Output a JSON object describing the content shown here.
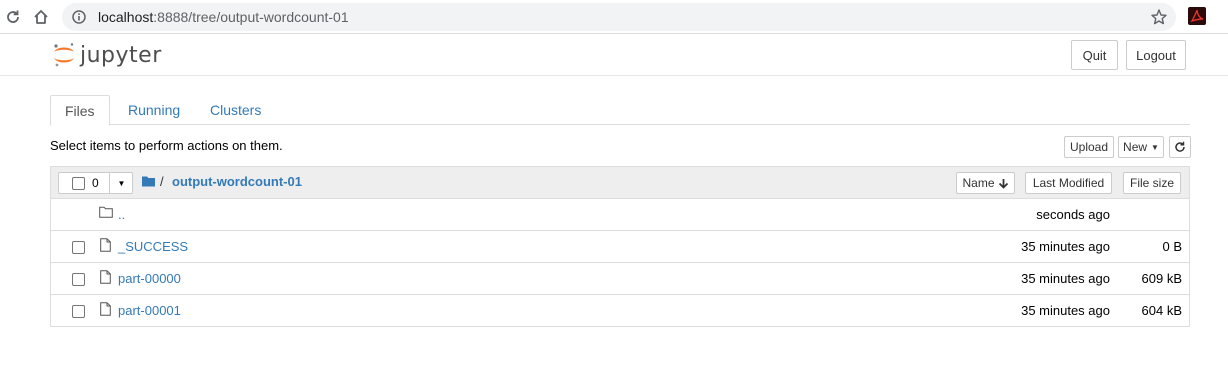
{
  "browser": {
    "url_host": "localhost",
    "url_path": ":8888/tree/output-wordcount-01"
  },
  "header": {
    "logo_text": "jupyter",
    "quit_label": "Quit",
    "logout_label": "Logout"
  },
  "tabs": [
    {
      "label": "Files",
      "active": true
    },
    {
      "label": "Running",
      "active": false
    },
    {
      "label": "Clusters",
      "active": false
    }
  ],
  "instructions": "Select items to perform actions on them.",
  "toolbar": {
    "upload_label": "Upload",
    "new_label": "New"
  },
  "list_header": {
    "selected_count": "0",
    "breadcrumb_sep": "/",
    "folder_name": "output-wordcount-01",
    "sort_name_label": "Name",
    "sort_modified_label": "Last Modified",
    "sort_size_label": "File size"
  },
  "items": [
    {
      "name": "..",
      "type": "folder",
      "modified": "seconds ago",
      "size": ""
    },
    {
      "name": "_SUCCESS",
      "type": "file",
      "modified": "35 minutes ago",
      "size": "0 B"
    },
    {
      "name": "part-00000",
      "type": "file",
      "modified": "35 minutes ago",
      "size": "609 kB"
    },
    {
      "name": "part-00001",
      "type": "file",
      "modified": "35 minutes ago",
      "size": "604 kB"
    }
  ],
  "colors": {
    "link": "#337ab7",
    "jupyter_orange": "#f37726"
  }
}
